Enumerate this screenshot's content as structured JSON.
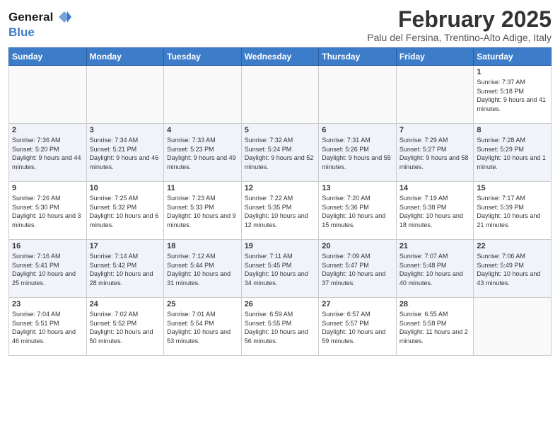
{
  "header": {
    "logo_line1": "General",
    "logo_line2": "Blue",
    "title": "February 2025",
    "subtitle": "Palu del Fersina, Trentino-Alto Adige, Italy"
  },
  "weekdays": [
    "Sunday",
    "Monday",
    "Tuesday",
    "Wednesday",
    "Thursday",
    "Friday",
    "Saturday"
  ],
  "weeks": [
    [
      {
        "day": "",
        "info": ""
      },
      {
        "day": "",
        "info": ""
      },
      {
        "day": "",
        "info": ""
      },
      {
        "day": "",
        "info": ""
      },
      {
        "day": "",
        "info": ""
      },
      {
        "day": "",
        "info": ""
      },
      {
        "day": "1",
        "info": "Sunrise: 7:37 AM\nSunset: 5:18 PM\nDaylight: 9 hours and 41 minutes."
      }
    ],
    [
      {
        "day": "2",
        "info": "Sunrise: 7:36 AM\nSunset: 5:20 PM\nDaylight: 9 hours and 44 minutes."
      },
      {
        "day": "3",
        "info": "Sunrise: 7:34 AM\nSunset: 5:21 PM\nDaylight: 9 hours and 46 minutes."
      },
      {
        "day": "4",
        "info": "Sunrise: 7:33 AM\nSunset: 5:23 PM\nDaylight: 9 hours and 49 minutes."
      },
      {
        "day": "5",
        "info": "Sunrise: 7:32 AM\nSunset: 5:24 PM\nDaylight: 9 hours and 52 minutes."
      },
      {
        "day": "6",
        "info": "Sunrise: 7:31 AM\nSunset: 5:26 PM\nDaylight: 9 hours and 55 minutes."
      },
      {
        "day": "7",
        "info": "Sunrise: 7:29 AM\nSunset: 5:27 PM\nDaylight: 9 hours and 58 minutes."
      },
      {
        "day": "8",
        "info": "Sunrise: 7:28 AM\nSunset: 5:29 PM\nDaylight: 10 hours and 1 minute."
      }
    ],
    [
      {
        "day": "9",
        "info": "Sunrise: 7:26 AM\nSunset: 5:30 PM\nDaylight: 10 hours and 3 minutes."
      },
      {
        "day": "10",
        "info": "Sunrise: 7:25 AM\nSunset: 5:32 PM\nDaylight: 10 hours and 6 minutes."
      },
      {
        "day": "11",
        "info": "Sunrise: 7:23 AM\nSunset: 5:33 PM\nDaylight: 10 hours and 9 minutes."
      },
      {
        "day": "12",
        "info": "Sunrise: 7:22 AM\nSunset: 5:35 PM\nDaylight: 10 hours and 12 minutes."
      },
      {
        "day": "13",
        "info": "Sunrise: 7:20 AM\nSunset: 5:36 PM\nDaylight: 10 hours and 15 minutes."
      },
      {
        "day": "14",
        "info": "Sunrise: 7:19 AM\nSunset: 5:38 PM\nDaylight: 10 hours and 18 minutes."
      },
      {
        "day": "15",
        "info": "Sunrise: 7:17 AM\nSunset: 5:39 PM\nDaylight: 10 hours and 21 minutes."
      }
    ],
    [
      {
        "day": "16",
        "info": "Sunrise: 7:16 AM\nSunset: 5:41 PM\nDaylight: 10 hours and 25 minutes."
      },
      {
        "day": "17",
        "info": "Sunrise: 7:14 AM\nSunset: 5:42 PM\nDaylight: 10 hours and 28 minutes."
      },
      {
        "day": "18",
        "info": "Sunrise: 7:12 AM\nSunset: 5:44 PM\nDaylight: 10 hours and 31 minutes."
      },
      {
        "day": "19",
        "info": "Sunrise: 7:11 AM\nSunset: 5:45 PM\nDaylight: 10 hours and 34 minutes."
      },
      {
        "day": "20",
        "info": "Sunrise: 7:09 AM\nSunset: 5:47 PM\nDaylight: 10 hours and 37 minutes."
      },
      {
        "day": "21",
        "info": "Sunrise: 7:07 AM\nSunset: 5:48 PM\nDaylight: 10 hours and 40 minutes."
      },
      {
        "day": "22",
        "info": "Sunrise: 7:06 AM\nSunset: 5:49 PM\nDaylight: 10 hours and 43 minutes."
      }
    ],
    [
      {
        "day": "23",
        "info": "Sunrise: 7:04 AM\nSunset: 5:51 PM\nDaylight: 10 hours and 46 minutes."
      },
      {
        "day": "24",
        "info": "Sunrise: 7:02 AM\nSunset: 5:52 PM\nDaylight: 10 hours and 50 minutes."
      },
      {
        "day": "25",
        "info": "Sunrise: 7:01 AM\nSunset: 5:54 PM\nDaylight: 10 hours and 53 minutes."
      },
      {
        "day": "26",
        "info": "Sunrise: 6:59 AM\nSunset: 5:55 PM\nDaylight: 10 hours and 56 minutes."
      },
      {
        "day": "27",
        "info": "Sunrise: 6:57 AM\nSunset: 5:57 PM\nDaylight: 10 hours and 59 minutes."
      },
      {
        "day": "28",
        "info": "Sunrise: 6:55 AM\nSunset: 5:58 PM\nDaylight: 11 hours and 2 minutes."
      },
      {
        "day": "",
        "info": ""
      }
    ]
  ]
}
